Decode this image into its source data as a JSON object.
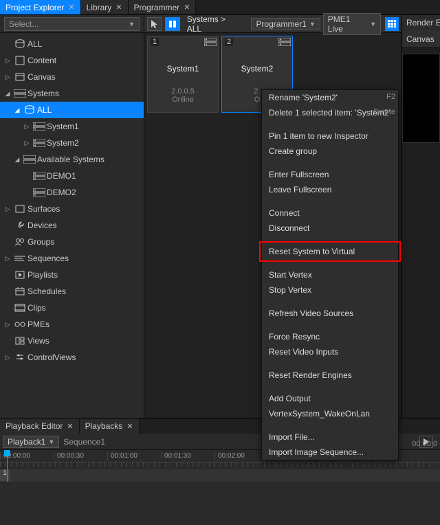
{
  "tabs": {
    "project_explorer": "Project Explorer",
    "library": "Library",
    "programmer": "Programmer",
    "render": "Render E"
  },
  "sidebar": {
    "select_placeholder": "Select...",
    "root": [
      {
        "label": "ALL",
        "icon": "db"
      },
      {
        "label": "Content",
        "icon": "box",
        "exp": true
      },
      {
        "label": "Canvas",
        "icon": "canvas",
        "exp": true
      },
      {
        "label": "Systems",
        "icon": "sys",
        "exp": true,
        "children": [
          {
            "label": "ALL",
            "icon": "db",
            "exp": true,
            "sel": true,
            "children": [
              {
                "label": "System1",
                "icon": "srv",
                "exp": true
              },
              {
                "label": "System2",
                "icon": "srv",
                "exp": true
              }
            ]
          },
          {
            "label": "Available Systems",
            "icon": "sys",
            "exp": true,
            "children": [
              {
                "label": "DEMO1",
                "icon": "srv"
              },
              {
                "label": "DEMO2",
                "icon": "srv"
              }
            ]
          }
        ]
      },
      {
        "label": "Surfaces",
        "icon": "square",
        "exp": true
      },
      {
        "label": "Devices",
        "icon": "wrench"
      },
      {
        "label": "Groups",
        "icon": "group"
      },
      {
        "label": "Sequences",
        "icon": "seq",
        "exp": true
      },
      {
        "label": "Playlists",
        "icon": "play"
      },
      {
        "label": "Schedules",
        "icon": "sched"
      },
      {
        "label": "Clips",
        "icon": "clip"
      },
      {
        "label": "PMEs",
        "icon": "pme",
        "exp": true
      },
      {
        "label": "Views",
        "icon": "views"
      },
      {
        "label": "ControlViews",
        "icon": "ctrl",
        "exp": true
      }
    ]
  },
  "toolbar": {
    "breadcrumb": "Systems > ALL",
    "programmer": "Programmer1",
    "pme": "PME1 Live",
    "canvas": "Canvas"
  },
  "cards": [
    {
      "num": "1",
      "title": "System1",
      "ver": "2.0.0.5",
      "stat": "Online",
      "sel": false
    },
    {
      "num": "2",
      "title": "System2",
      "ver": "2.",
      "stat": "O",
      "sel": true
    }
  ],
  "context_menu": [
    {
      "t": "Rename 'System2'",
      "sc": "F2"
    },
    {
      "t": "Delete 1 selected item: 'System2'",
      "sc": "Delete"
    },
    {
      "sep": true
    },
    {
      "t": "Pin 1 item to new Inspector"
    },
    {
      "t": "Create group"
    },
    {
      "sep": true
    },
    {
      "t": "Enter Fullscreen"
    },
    {
      "t": "Leave Fullscreen"
    },
    {
      "sep": true
    },
    {
      "t": "Connect"
    },
    {
      "t": "Disconnect"
    },
    {
      "sep": true
    },
    {
      "t": "Reset System to Virtual",
      "hl": true
    },
    {
      "sep": true
    },
    {
      "t": "Start Vertex"
    },
    {
      "t": "Stop Vertex"
    },
    {
      "sep": true
    },
    {
      "t": "Refresh Video Sources"
    },
    {
      "sep": true
    },
    {
      "t": "Force Resync"
    },
    {
      "t": "Reset Video Inputs"
    },
    {
      "sep": true
    },
    {
      "t": "Reset Render Engines"
    },
    {
      "sep": true
    },
    {
      "t": "Add Output"
    },
    {
      "t": "VertexSystem_WakeOnLan"
    },
    {
      "sep": true
    },
    {
      "t": "Import File..."
    },
    {
      "t": "Import Image Sequence..."
    }
  ],
  "playback": {
    "tabs": {
      "editor": "Playback Editor",
      "playbacks": "Playbacks"
    },
    "dd": "Playback1",
    "seq": "Sequence1",
    "times": [
      "00:00:00",
      "00:00:30",
      "00:01:00",
      "00:01:30",
      "00:02:00"
    ],
    "track": "1",
    "right_time": "00:00:0"
  }
}
